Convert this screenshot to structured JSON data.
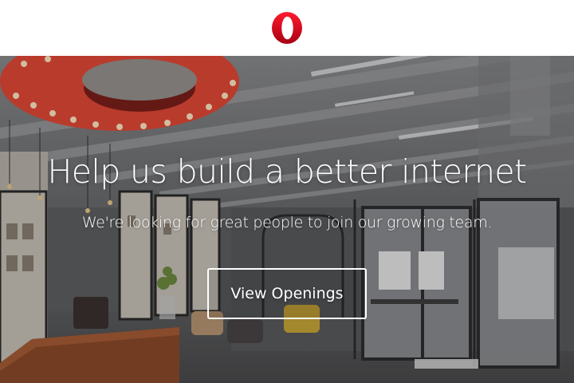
{
  "header": {
    "logo_icon": "opera-logo-icon",
    "brand_color": "#e0101e"
  },
  "hero": {
    "title": "Help us build a better internet",
    "subtitle": "We're looking for great people to join our growing team.",
    "cta_label": "View Openings",
    "background": "office-interior-photo"
  }
}
